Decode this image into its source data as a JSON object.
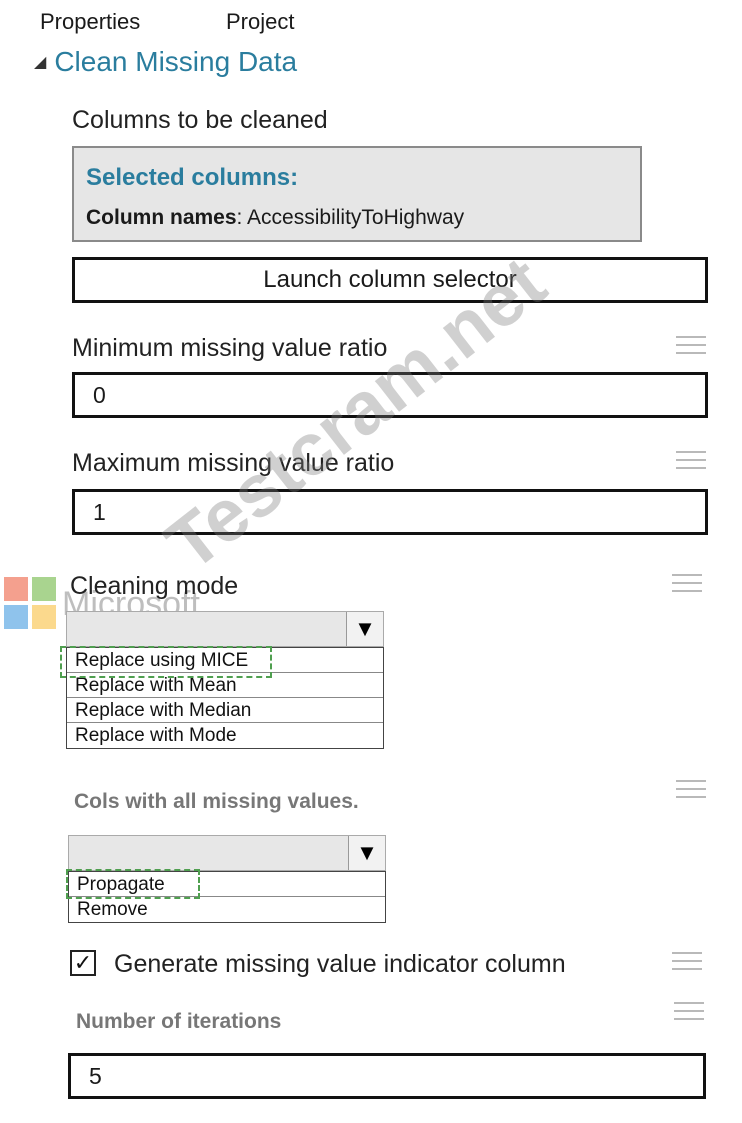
{
  "tabs": [
    "Properties",
    "Project"
  ],
  "section": {
    "title": "Clean Missing Data"
  },
  "columns_to_clean": {
    "label": "Columns to be cleaned",
    "selected_header": "Selected columns:",
    "column_names_label": "Column names",
    "column_names_value": "AccessibilityToHighway",
    "launch_button": "Launch column selector"
  },
  "min_ratio": {
    "label": "Minimum missing value ratio",
    "value": "0"
  },
  "max_ratio": {
    "label": "Maximum missing value ratio",
    "value": "1"
  },
  "cleaning_mode": {
    "label": "Cleaning mode",
    "selected": "",
    "options": [
      "Replace using MICE",
      "Replace with Mean",
      "Replace with Median",
      "Replace with Mode"
    ]
  },
  "cols_all_missing": {
    "label": "Cols with all missing values.",
    "selected": "",
    "options": [
      "Propagate",
      "Remove"
    ]
  },
  "indicator": {
    "label": "Generate missing value indicator column",
    "checked": true
  },
  "iterations": {
    "label": "Number of iterations",
    "value": "5"
  },
  "watermark": {
    "text": "Testcram.net",
    "brand": "Microsoft"
  },
  "colors": {
    "accent": "#2a7d9e",
    "dash_highlight": "#4f9f4f"
  }
}
